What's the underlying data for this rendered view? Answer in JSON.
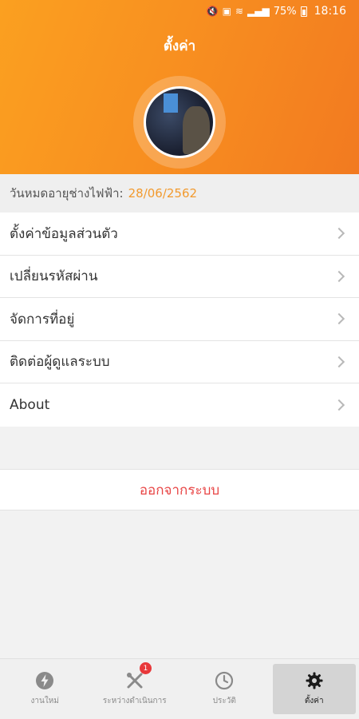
{
  "status_bar": {
    "battery": "75%",
    "time": "18:16"
  },
  "header": {
    "title": "ตั้งค่า"
  },
  "expiry": {
    "label": "วันหมดอายุช่างไฟฟ้า:",
    "date": "28/06/2562"
  },
  "menu": {
    "items": [
      {
        "label": "ตั้งค่าข้อมูลส่วนตัว"
      },
      {
        "label": "เปลี่ยนรหัสผ่าน"
      },
      {
        "label": "จัดการที่อยู่"
      },
      {
        "label": "ติดต่อผู้ดูแลระบบ"
      },
      {
        "label": "About"
      }
    ]
  },
  "logout": {
    "label": "ออกจากระบบ"
  },
  "bottom_nav": {
    "items": [
      {
        "label": "งานใหม่",
        "icon": "lightning-icon"
      },
      {
        "label": "ระหว่างดำเนินการ",
        "icon": "tools-icon",
        "badge": "1"
      },
      {
        "label": "ประวัติ",
        "icon": "clock-icon"
      },
      {
        "label": "ตั้งค่า",
        "icon": "gear-icon",
        "active": true
      }
    ]
  },
  "colors": {
    "accent": "#f7941d",
    "date": "#f29a2e",
    "logout": "#e84545",
    "badge": "#e8383a"
  }
}
